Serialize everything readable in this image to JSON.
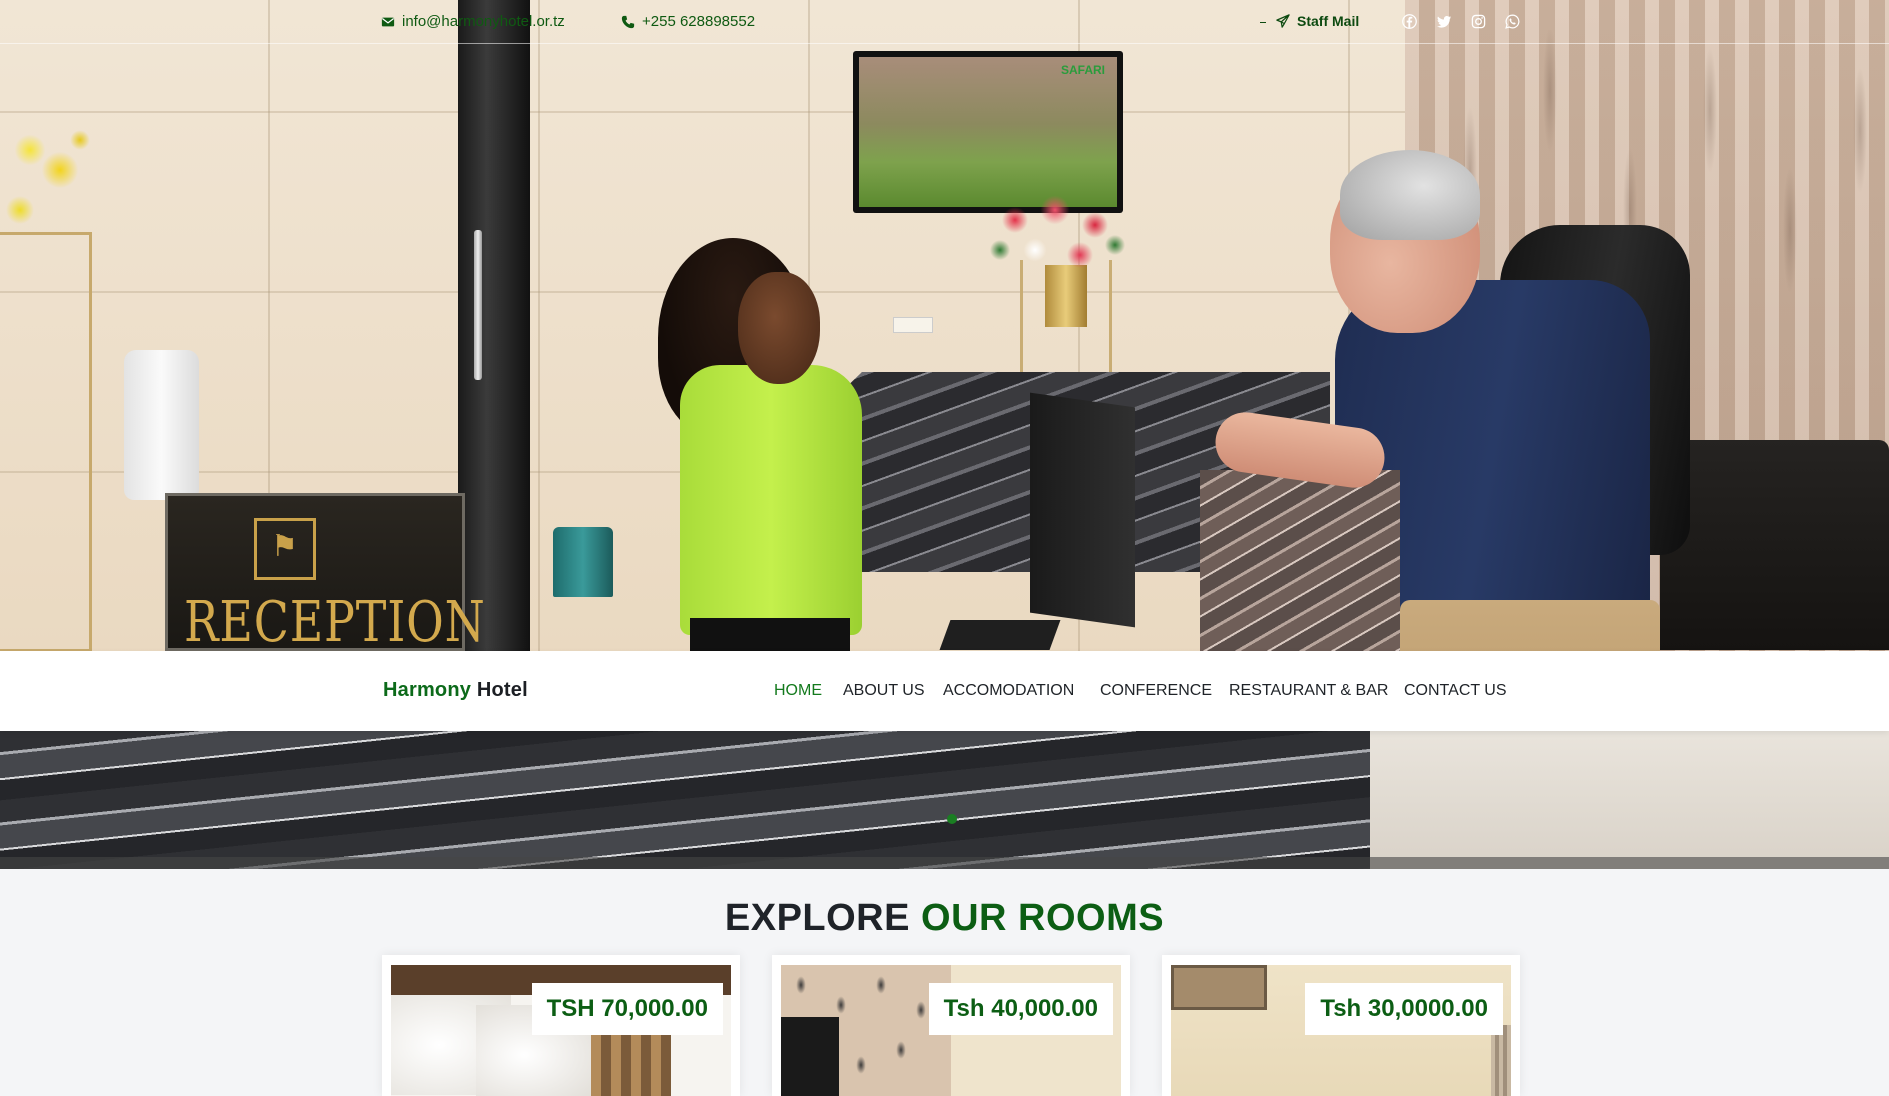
{
  "topbar": {
    "email": "info@harmonyhotel.or.tz",
    "phone": "+255 628898552",
    "staff_mail": "Staff Mail",
    "social": [
      "facebook-icon",
      "twitter-icon",
      "instagram-icon",
      "whatsapp-icon"
    ]
  },
  "hero": {
    "reception_sign": "RECEPTION",
    "tv_logo": "SAFARI"
  },
  "navbar": {
    "brand_part1": "Harmony",
    "brand_part2": "Hotel",
    "items": [
      {
        "label": "HOME",
        "active": true
      },
      {
        "label": "ABOUT US",
        "active": false
      },
      {
        "label": "ACCOMODATION",
        "active": false
      },
      {
        "label": "CONFERENCE",
        "active": false
      },
      {
        "label": "RESTAURANT & BAR",
        "active": false
      },
      {
        "label": "CONTACT US",
        "active": false
      }
    ]
  },
  "rooms": {
    "title_part1": "EXPLORE",
    "title_part2": "OUR ROOMS",
    "cards": [
      {
        "price": "TSH 70,000.00"
      },
      {
        "price": "Tsh 40,000.00"
      },
      {
        "price": "Tsh 30,0000.00"
      }
    ]
  },
  "colors": {
    "brand_green": "#0c5e14",
    "active_nav": "#137a1d",
    "text_dark": "#1f2329"
  }
}
